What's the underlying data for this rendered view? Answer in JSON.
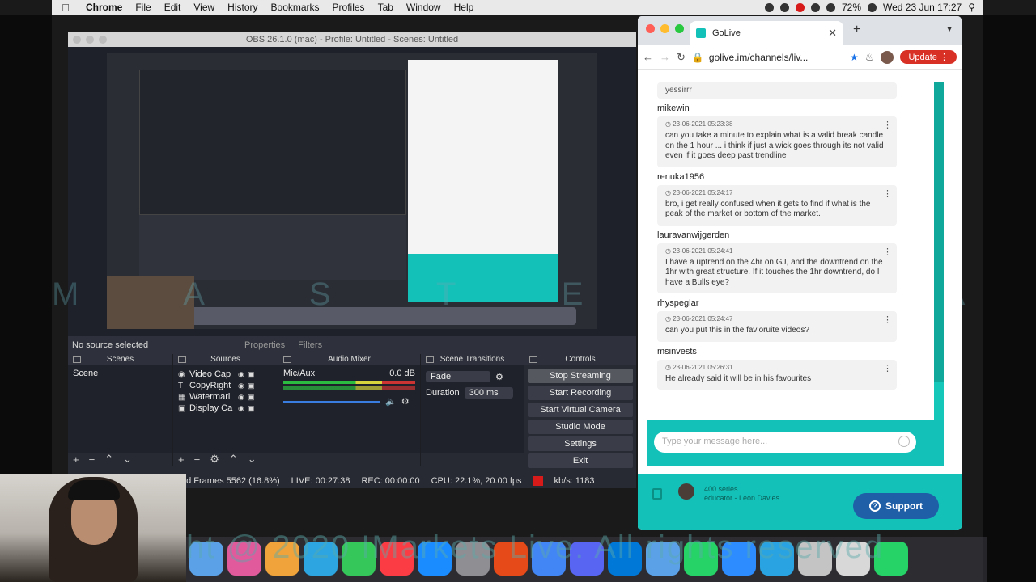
{
  "menubar": {
    "app": "Chrome",
    "items": [
      "File",
      "Edit",
      "View",
      "History",
      "Bookmarks",
      "Profiles",
      "Tab",
      "Window",
      "Help"
    ],
    "battery": "72%",
    "datetime": "Wed 23 Jun  17:27"
  },
  "obs": {
    "title": "OBS 26.1.0 (mac) - Profile: Untitled - Scenes: Untitled",
    "no_source": "No source selected",
    "properties_tab": "Properties",
    "filters_tab": "Filters",
    "docks": {
      "scenes": "Scenes",
      "sources": "Sources",
      "mixer": "Audio Mixer",
      "transitions": "Scene Transitions",
      "controls": "Controls"
    },
    "scene_list": [
      "Scene"
    ],
    "sources": [
      {
        "name": "Video Cap",
        "icon": "camera-icon"
      },
      {
        "name": "CopyRight",
        "icon": "text-icon"
      },
      {
        "name": "Watermarl",
        "icon": "image-icon"
      },
      {
        "name": "Display Ca",
        "icon": "display-icon"
      }
    ],
    "mixer": {
      "channel": "Mic/Aux",
      "level": "0.0 dB"
    },
    "transition": {
      "type": "Fade",
      "duration_label": "Duration",
      "duration_value": "300 ms"
    },
    "controls": [
      "Stop Streaming",
      "Start Recording",
      "Start Virtual Camera",
      "Studio Mode",
      "Settings",
      "Exit"
    ],
    "status": {
      "dropped": "ed Frames 5562 (16.8%)",
      "live": "LIVE: 00:27:38",
      "rec": "REC: 00:00:00",
      "cpu": "CPU: 22.1%, 20.00 fps",
      "kbs": "kb/s: 1183"
    }
  },
  "browser": {
    "tab_title": "GoLive",
    "url": "golive.im/channels/liv...",
    "update_label": "Update",
    "chat": {
      "previous": "yessirrr",
      "messages": [
        {
          "user": "mikewin",
          "time": "23-06-2021 05:23:38",
          "text": "can you take a minute to explain what is a valid break candle on the 1 hour ... i think if just a wick goes through its not valid even if it goes deep past trendline"
        },
        {
          "user": "renuka1956",
          "time": "23-06-2021 05:24:17",
          "text": "bro, i get really confused when it gets to find if what is the peak of the market or bottom of the market."
        },
        {
          "user": "lauravanwijgerden",
          "time": "23-06-2021 05:24:41",
          "text": "I have a uptrend on the 4hr on GJ, and the downtrend on the 1hr with great structure. If it touches the 1hr downtrend, do I have a Bulls eye?"
        },
        {
          "user": "rhyspeglar",
          "time": "23-06-2021 05:24:47",
          "text": "can you put this in the favioruite videos?"
        },
        {
          "user": "msinvests",
          "time": "23-06-2021 05:26:31",
          "text": "He already said it will be in his favourites"
        }
      ],
      "input_placeholder": "Type your message here..."
    },
    "footer": {
      "series": "400 series",
      "educator": "educator - Leon Davies",
      "support_label": "Support"
    }
  },
  "watermark_text": "M A S T E R Y   A C A D E M Y",
  "copyright_text": "ht @ 2020 IMarkets Live. All rights reserved",
  "dock_apps": [
    "#5aa1e8",
    "#e05a9c",
    "#f0a33a",
    "#2ca5e0",
    "#35c759",
    "#fc3c44",
    "#1a8cff",
    "#8e8e93",
    "#e64a19",
    "#4285f4",
    "#5865f2",
    "#0078d7",
    "#5aa1e8",
    "#25d366",
    "#2d8cff",
    "#2aa3e2",
    "#c4c4c4",
    "#d8d8d8",
    "#25d366"
  ]
}
